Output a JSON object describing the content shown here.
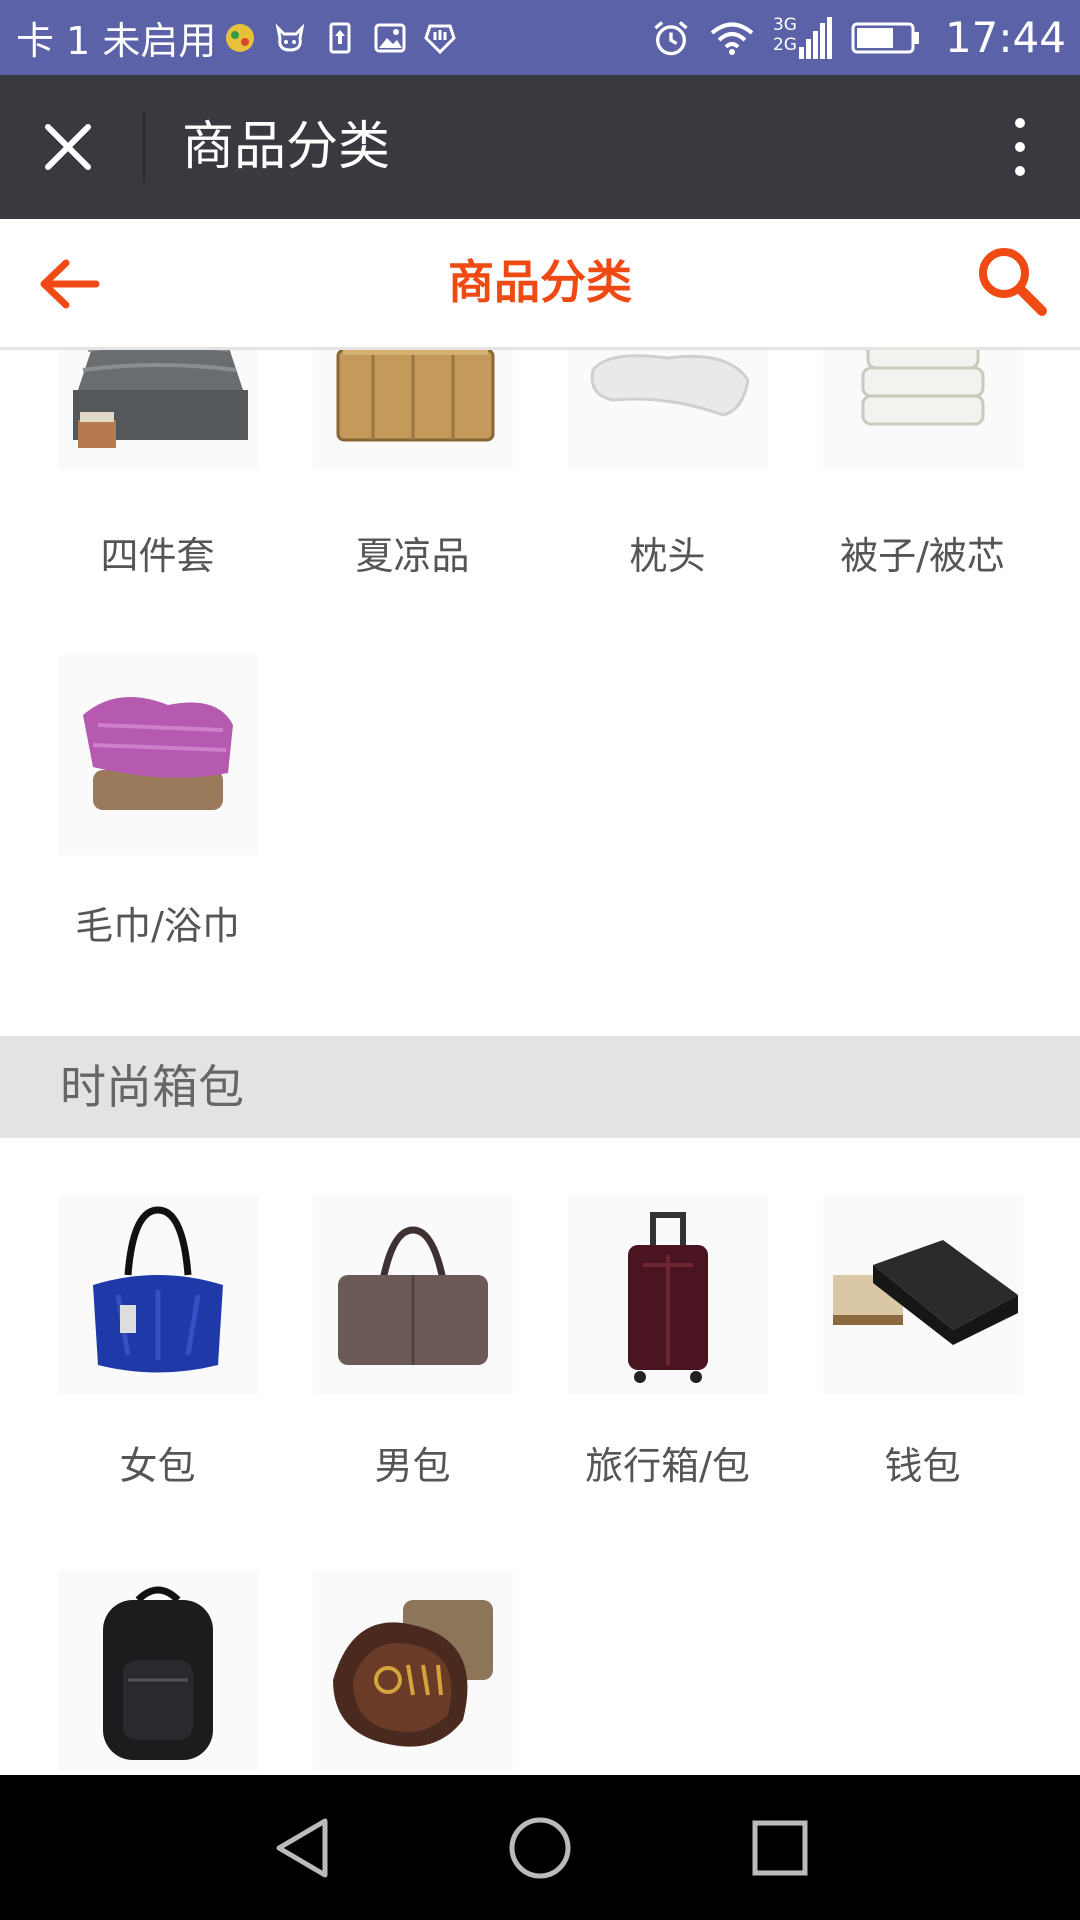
{
  "status_bar": {
    "carrier": "卡 1 未启用",
    "network": "3G 2G",
    "time": "17:44",
    "color": "#5b62a8",
    "icons": [
      "app-notification-icon",
      "cow-icon",
      "upload-icon",
      "image-icon",
      "hand-icon",
      "alarm-icon",
      "wifi-icon",
      "signal-icon",
      "battery-icon"
    ]
  },
  "app_bar": {
    "title": "商品分类",
    "close_icon": "close-icon",
    "more_icon": "more-vert-icon",
    "color": "#393a3f"
  },
  "page_header": {
    "title": "商品分类",
    "accent": "#f04a14",
    "back_icon": "arrow-left-icon",
    "search_icon": "search-icon"
  },
  "sections": [
    {
      "items": [
        {
          "label": "四件套",
          "image": "bedding-set"
        },
        {
          "label": "夏凉品",
          "image": "summer-mat"
        },
        {
          "label": "枕头",
          "image": "pillow"
        },
        {
          "label": "被子/被芯",
          "image": "quilt"
        },
        {
          "label": "毛巾/浴巾",
          "image": "towel"
        }
      ]
    },
    {
      "name": "时尚箱包",
      "items": [
        {
          "label": "女包",
          "image": "womens-bag"
        },
        {
          "label": "男包",
          "image": "mens-bag"
        },
        {
          "label": "旅行箱/包",
          "image": "suitcase"
        },
        {
          "label": "钱包",
          "image": "wallet"
        },
        {
          "label": "",
          "image": "backpack"
        },
        {
          "label": "",
          "image": "key-pouch"
        }
      ]
    }
  ],
  "nav_bar": {
    "icons": [
      "back-triangle-icon",
      "home-circle-icon",
      "recents-square-icon"
    ]
  }
}
